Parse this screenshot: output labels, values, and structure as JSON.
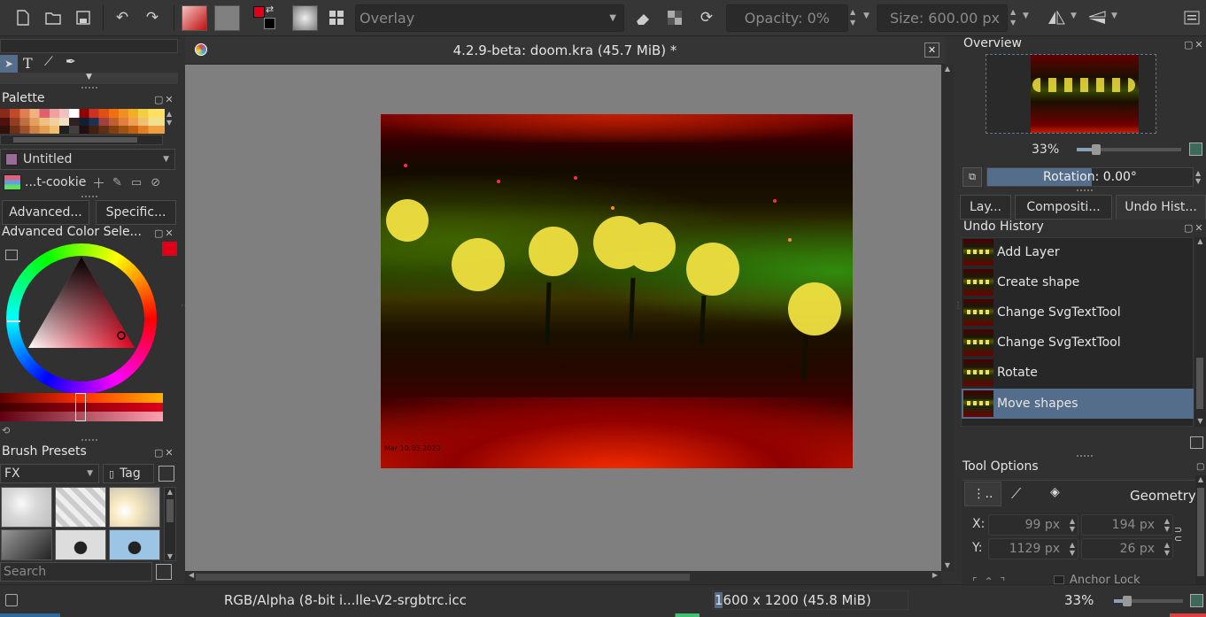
{
  "toolbar": {
    "blend_mode": "Overlay",
    "opacity": "Opacity: 0%",
    "size": "Size: 600.00 px"
  },
  "document": {
    "title": "4.2.9-beta: doom.kra (45.7 MiB) *",
    "canvas_signature": "Mar 10.03.2020"
  },
  "left_dock": {
    "palette": {
      "header": "Palette",
      "selected_name": "Untitled",
      "cookie_label": "...t-cookie"
    },
    "color_tabs": [
      "Advanced...",
      "Specific..."
    ],
    "advanced_color_header": "Advanced Color Sele...",
    "brush_presets": {
      "header": "Brush Presets",
      "filter": "FX",
      "tag_label": "Tag",
      "search_placeholder": "Search"
    }
  },
  "right_dock": {
    "overview": {
      "header": "Overview",
      "zoom": "33%",
      "rotation": "Rotation: 0.00°"
    },
    "tabs": [
      "Lay...",
      "Compositi...",
      "Undo Hist..."
    ],
    "undo_history": {
      "header": "Undo History",
      "items": [
        "Add Layer",
        "Create shape",
        "Change SvgTextTool",
        "Change SvgTextTool",
        "Rotate",
        "Move shapes"
      ],
      "selected_index": 5
    },
    "tool_options": {
      "header": "Tool Options",
      "mode_label": "Geometry",
      "x_label": "X:",
      "y_label": "Y:",
      "x_value": "99 px",
      "y_value": "1129 px",
      "w_value": "194 px",
      "h_value": "26 px",
      "anchor_label": "Anchor Lock"
    }
  },
  "statusbar": {
    "color_profile": "RGB/Alpha (8-bit i...lle-V2-srgbtrc.icc",
    "image_size": "1600 x 1200 (45.8 MiB)",
    "zoom": "33%"
  },
  "colors": {
    "accent_selected": "#536d8a",
    "foreground_color": "#e0001a",
    "background_color": "#000000"
  }
}
